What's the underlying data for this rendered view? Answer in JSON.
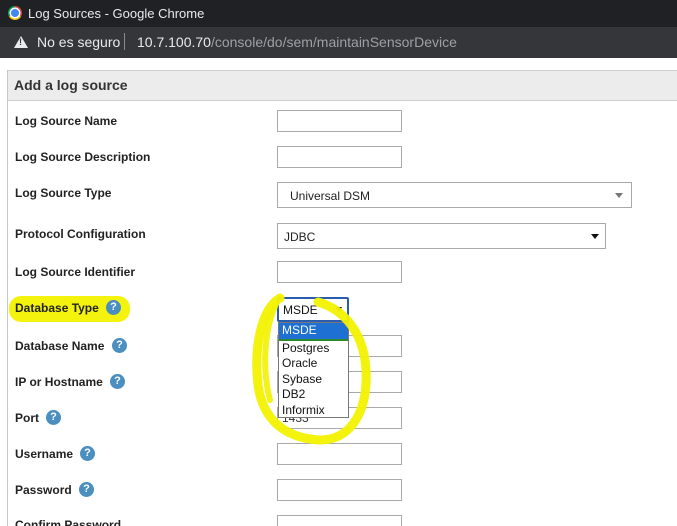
{
  "window": {
    "title": "Log Sources - Google Chrome"
  },
  "addressbar": {
    "security_label": "No es seguro",
    "url_host": "10.7.100.70",
    "url_path": "/console/do/sem/maintainSensorDevice"
  },
  "panel": {
    "heading": "Add a log source"
  },
  "fields": {
    "log_source_name": {
      "label": "Log Source Name",
      "value": ""
    },
    "log_source_description": {
      "label": "Log Source Description",
      "value": ""
    },
    "log_source_type": {
      "label": "Log Source Type",
      "value": "Universal DSM"
    },
    "protocol_configuration": {
      "label": "Protocol Configuration",
      "value": "JDBC"
    },
    "log_source_identifier": {
      "label": "Log Source Identifier",
      "value": ""
    },
    "database_type": {
      "label": "Database Type",
      "value": "MSDE",
      "options": [
        "MSDE",
        "Postgres",
        "Oracle",
        "Sybase",
        "DB2",
        "Informix"
      ],
      "selected_index": 0
    },
    "database_name": {
      "label": "Database Name",
      "value": ""
    },
    "ip_or_hostname": {
      "label": "IP or Hostname",
      "value": ""
    },
    "port": {
      "label": "Port",
      "value": "1433"
    },
    "username": {
      "label": "Username",
      "value": ""
    },
    "password": {
      "label": "Password",
      "value": ""
    },
    "confirm_password": {
      "label": "Confirm Password",
      "value": ""
    }
  },
  "icons": {
    "help": "?"
  },
  "colors": {
    "highlight": "#f2f200",
    "help_icon": "#4a8fbf",
    "selection": "#1e70d2"
  }
}
